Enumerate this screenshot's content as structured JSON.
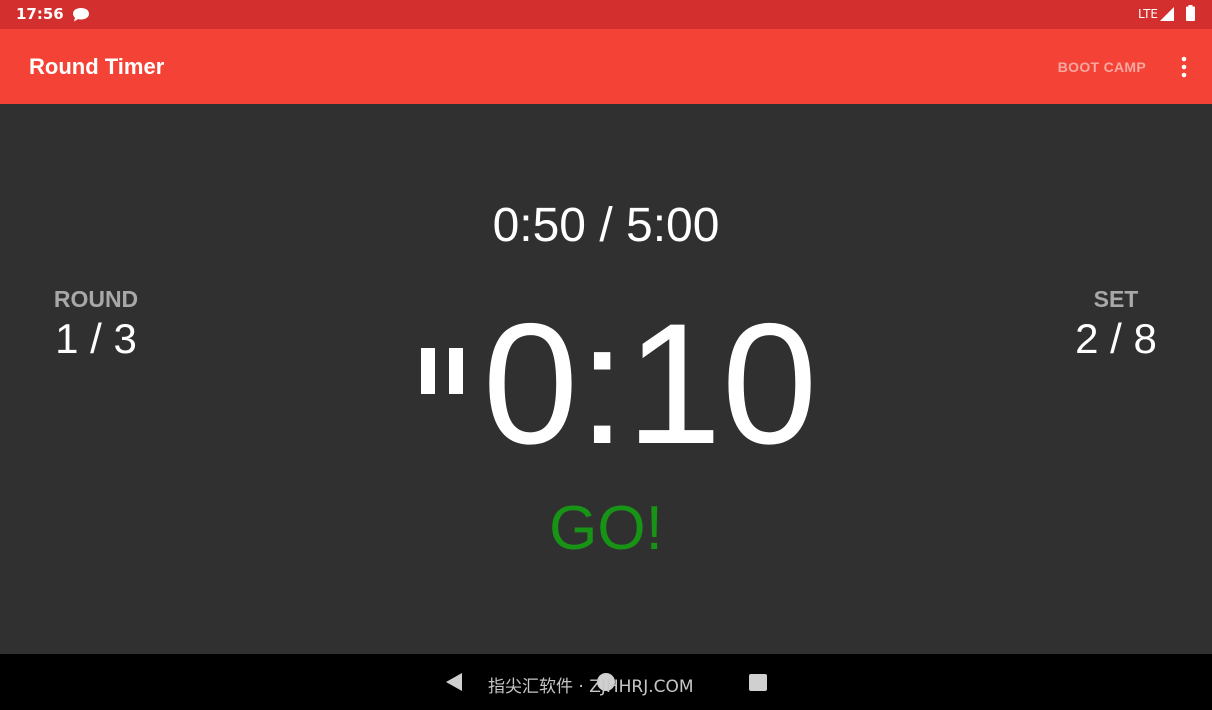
{
  "status_bar": {
    "time": "17:56",
    "network": "LTE",
    "notification_icon": "chat-bubble-icon",
    "signal_icon": "signal-icon",
    "battery_icon": "battery-icon"
  },
  "app_bar": {
    "title": "Round Timer",
    "action_label": "BOOT CAMP",
    "menu_icon": "more-vert-icon"
  },
  "timer": {
    "elapsed": "0:50 / 5:00",
    "countdown": "0:10",
    "status": "GO!",
    "pause_icon": "pause-icon"
  },
  "round": {
    "label": "ROUND",
    "value": "1 / 3"
  },
  "set": {
    "label": "SET",
    "value": "2 / 8"
  },
  "nav_bar": {
    "back_icon": "back-triangle-icon",
    "home_icon": "home-circle-icon",
    "recents_icon": "recents-square-icon",
    "watermark": "指尖汇软件 · ZJHHRJ.COM"
  },
  "colors": {
    "status_bar": "#d32f2f",
    "app_bar": "#f44336",
    "background": "#303030",
    "go": "#179316",
    "label_gray": "#a8a8a8"
  }
}
